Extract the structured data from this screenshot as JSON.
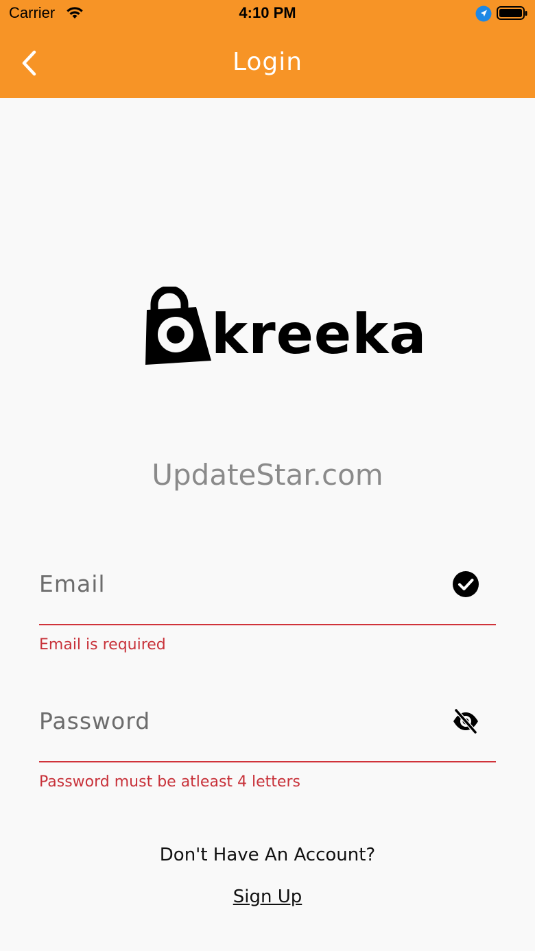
{
  "status_bar": {
    "carrier": "Carrier",
    "time": "4:10 PM",
    "icons": [
      "wifi-icon",
      "location-arrow-icon",
      "battery-icon"
    ]
  },
  "nav": {
    "back_icon": "chevron-left-icon",
    "title": "Login"
  },
  "logo": {
    "brand_text": "kreeka",
    "mark_icon": "shopping-bag-icon"
  },
  "watermark": "UpdateStar.com",
  "form": {
    "email": {
      "placeholder": "Email",
      "value": "",
      "icon": "check-circle-icon",
      "error": "Email is required"
    },
    "password": {
      "placeholder": "Password",
      "value": "",
      "icon": "eye-off-icon",
      "error": "Password must be atleast 4 letters"
    }
  },
  "footer": {
    "prompt": "Don't Have An Account?",
    "signup_label": "Sign Up"
  },
  "colors": {
    "header": "#f79426",
    "error": "#c8323a",
    "underline": "#d0333a",
    "background": "#f9f9f9"
  }
}
